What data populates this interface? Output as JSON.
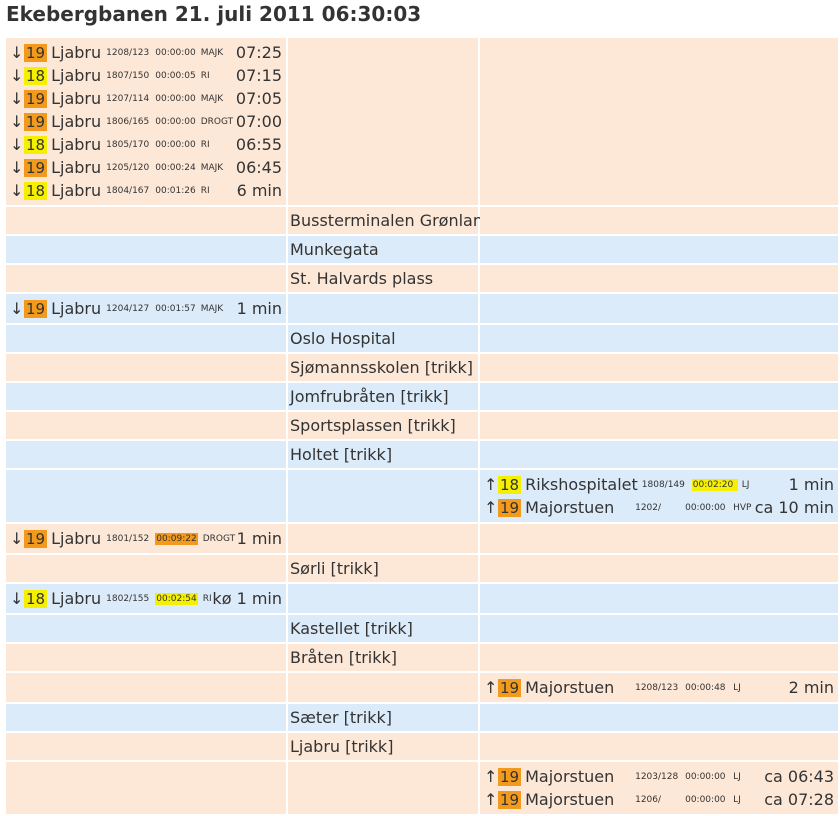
{
  "title": "Ekebergbanen 21. juli 2011 06:30:03",
  "colors": {
    "peach_row": "#fde8d8",
    "blue_row": "#dcebfa",
    "line_19": "#f29a1d",
    "line_18": "#f5f000",
    "highlight_orange": "#f29a1d",
    "highlight_yellow": "#f5f000"
  },
  "rows": [
    {
      "bg": "peach",
      "stop": "",
      "down": [
        {
          "arrow": "↓",
          "line": "19",
          "dest": "Ljabru",
          "ids": "1208/123",
          "ts": "00:00:00",
          "ts_hl": "",
          "driver": "MAJK",
          "time": "07:25"
        },
        {
          "arrow": "↓",
          "line": "18",
          "dest": "Ljabru",
          "ids": "1807/150",
          "ts": "00:00:05",
          "ts_hl": "",
          "driver": "RI",
          "time": "07:15"
        },
        {
          "arrow": "↓",
          "line": "19",
          "dest": "Ljabru",
          "ids": "1207/114",
          "ts": "00:00:00",
          "ts_hl": "",
          "driver": "MAJK",
          "time": "07:05"
        },
        {
          "arrow": "↓",
          "line": "19",
          "dest": "Ljabru",
          "ids": "1806/165",
          "ts": "00:00:00",
          "ts_hl": "",
          "driver": "DROGT",
          "time": "07:00"
        },
        {
          "arrow": "↓",
          "line": "18",
          "dest": "Ljabru",
          "ids": "1805/170",
          "ts": "00:00:00",
          "ts_hl": "",
          "driver": "RI",
          "time": "06:55"
        },
        {
          "arrow": "↓",
          "line": "19",
          "dest": "Ljabru",
          "ids": "1205/120",
          "ts": "00:00:24",
          "ts_hl": "",
          "driver": "MAJK",
          "time": "06:45"
        },
        {
          "arrow": "↓",
          "line": "18",
          "dest": "Ljabru",
          "ids": "1804/167",
          "ts": "00:01:26",
          "ts_hl": "",
          "driver": "RI",
          "time": "6 min"
        }
      ],
      "up": []
    },
    {
      "bg": "peach",
      "stop": "Bussterminalen Grønland",
      "down": [],
      "up": []
    },
    {
      "bg": "blue",
      "stop": "Munkegata",
      "down": [],
      "up": []
    },
    {
      "bg": "peach",
      "stop": "St. Halvards plass",
      "down": [],
      "up": []
    },
    {
      "bg": "blue",
      "stop": "",
      "down": [
        {
          "arrow": "↓",
          "line": "19",
          "dest": "Ljabru",
          "ids": "1204/127",
          "ts": "00:01:57",
          "ts_hl": "",
          "driver": "MAJK",
          "time": "1 min"
        }
      ],
      "up": []
    },
    {
      "bg": "blue",
      "stop": "Oslo Hospital",
      "down": [],
      "up": []
    },
    {
      "bg": "peach",
      "stop": "Sjømannsskolen [trikk]",
      "down": [],
      "up": []
    },
    {
      "bg": "blue",
      "stop": "Jomfrubråten [trikk]",
      "down": [],
      "up": []
    },
    {
      "bg": "peach",
      "stop": "Sportsplassen [trikk]",
      "down": [],
      "up": []
    },
    {
      "bg": "blue",
      "stop": "Holtet [trikk]",
      "down": [],
      "up": []
    },
    {
      "bg": "blue",
      "stop": "",
      "down": [],
      "up": [
        {
          "arrow": "↑",
          "line": "18",
          "dest": "Rikshospitalet",
          "ids": "1808/149",
          "ts": "00:02:20",
          "ts_hl": "yellow",
          "driver": "LJ",
          "time": "1 min"
        },
        {
          "arrow": "↑",
          "line": "19",
          "dest": "Majorstuen",
          "ids": "1202/",
          "ts": "00:00:00",
          "ts_hl": "",
          "driver": "HVP",
          "time": "ca 10 min"
        }
      ]
    },
    {
      "bg": "peach",
      "stop": "",
      "down": [
        {
          "arrow": "↓",
          "line": "19",
          "dest": "Ljabru",
          "ids": "1801/152",
          "ts": "00:09:22",
          "ts_hl": "orange",
          "driver": "DROGT",
          "time": "1 min"
        }
      ],
      "up": []
    },
    {
      "bg": "peach",
      "stop": "Sørli [trikk]",
      "down": [],
      "up": []
    },
    {
      "bg": "blue",
      "stop": "",
      "down": [
        {
          "arrow": "↓",
          "line": "18",
          "dest": "Ljabru",
          "ids": "1802/155",
          "ts": "00:02:54",
          "ts_hl": "yellow",
          "driver": "RI",
          "time": "kø 1 min"
        }
      ],
      "up": []
    },
    {
      "bg": "blue",
      "stop": "Kastellet [trikk]",
      "down": [],
      "up": []
    },
    {
      "bg": "peach",
      "stop": "Bråten [trikk]",
      "down": [],
      "up": []
    },
    {
      "bg": "peach",
      "stop": "",
      "down": [],
      "up": [
        {
          "arrow": "↑",
          "line": "19",
          "dest": "Majorstuen",
          "ids": "1208/123",
          "ts": "00:00:48",
          "ts_hl": "",
          "driver": "LJ",
          "time": "2 min"
        }
      ]
    },
    {
      "bg": "blue",
      "stop": "Sæter [trikk]",
      "down": [],
      "up": []
    },
    {
      "bg": "peach",
      "stop": "Ljabru [trikk]",
      "down": [],
      "up": []
    },
    {
      "bg": "peach",
      "stop": "",
      "down": [],
      "up": [
        {
          "arrow": "↑",
          "line": "19",
          "dest": "Majorstuen",
          "ids": "1203/128",
          "ts": "00:00:00",
          "ts_hl": "",
          "driver": "LJ",
          "time": "ca 06:43"
        },
        {
          "arrow": "↑",
          "line": "19",
          "dest": "Majorstuen",
          "ids": "1206/",
          "ts": "00:00:00",
          "ts_hl": "",
          "driver": "LJ",
          "time": "ca 07:28"
        }
      ]
    }
  ]
}
